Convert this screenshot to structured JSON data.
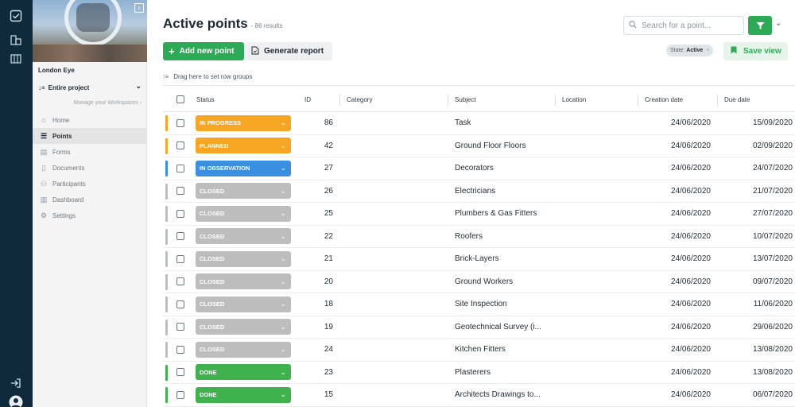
{
  "app": {
    "project_name": "London Eye",
    "scope": "Entire project",
    "manage_workspaces": "Manage your Workspaces"
  },
  "rail": {
    "icons": [
      "check-square-icon",
      "buildings-icon",
      "map-icon",
      "logout-icon",
      "user-avatar-icon"
    ]
  },
  "nav": [
    {
      "label": "Home",
      "icon": "home-icon"
    },
    {
      "label": "Points",
      "icon": "list-icon",
      "active": true
    },
    {
      "label": "Forms",
      "icon": "clipboard-icon"
    },
    {
      "label": "Documents",
      "icon": "document-icon"
    },
    {
      "label": "Participants",
      "icon": "people-icon"
    },
    {
      "label": "Dashboard",
      "icon": "chart-icon"
    },
    {
      "label": "Settings",
      "icon": "gear-icon"
    }
  ],
  "header": {
    "title": "Active points",
    "result_count": "- 86 results",
    "search_placeholder": "Search for a point...",
    "add_button": "Add new point",
    "report_button": "Generate report",
    "filter_chip_label": "State:",
    "filter_chip_value": "Active",
    "save_view_button": "Save view",
    "group_hint": "Drag here to set row groups"
  },
  "columns": {
    "status": "Status",
    "id": "ID",
    "category": "Category",
    "subject": "Subject",
    "location": "Location",
    "creation_date": "Creation date",
    "due_date": "Due date"
  },
  "status_colors": {
    "IN PROGRESS": "#f6a623",
    "PLANNED": "#f6a623",
    "IN OBSERVATION": "#3a8fe0",
    "CLOSED": "#bdbdbd",
    "DONE": "#3fb14d"
  },
  "rows": [
    {
      "status": "IN PROGRESS",
      "id": "86",
      "subject": "Task",
      "created": "24/06/2020",
      "due": "15/09/2020"
    },
    {
      "status": "PLANNED",
      "id": "42",
      "subject": "Ground Floor Floors",
      "created": "24/06/2020",
      "due": "02/09/2020"
    },
    {
      "status": "IN OBSERVATION",
      "id": "27",
      "subject": "Decorators",
      "created": "24/06/2020",
      "due": "24/07/2020"
    },
    {
      "status": "CLOSED",
      "id": "26",
      "subject": "Electricians",
      "created": "24/06/2020",
      "due": "21/07/2020"
    },
    {
      "status": "CLOSED",
      "id": "25",
      "subject": "Plumbers & Gas Fitters",
      "created": "24/06/2020",
      "due": "27/07/2020"
    },
    {
      "status": "CLOSED",
      "id": "22",
      "subject": "Roofers",
      "created": "24/06/2020",
      "due": "10/07/2020"
    },
    {
      "status": "CLOSED",
      "id": "21",
      "subject": "Brick-Layers",
      "created": "24/06/2020",
      "due": "13/07/2020"
    },
    {
      "status": "CLOSED",
      "id": "20",
      "subject": "Ground Workers",
      "created": "24/06/2020",
      "due": "09/07/2020"
    },
    {
      "status": "CLOSED",
      "id": "18",
      "subject": "Site Inspection",
      "created": "24/06/2020",
      "due": "11/06/2020"
    },
    {
      "status": "CLOSED",
      "id": "19",
      "subject": "Geotechnical Survey (i...",
      "created": "24/06/2020",
      "due": "29/06/2020"
    },
    {
      "status": "CLOSED",
      "id": "24",
      "subject": "Kitchen Fitters",
      "created": "24/06/2020",
      "due": "13/08/2020"
    },
    {
      "status": "DONE",
      "id": "23",
      "subject": "Plasterers",
      "created": "24/06/2020",
      "due": "13/08/2020"
    },
    {
      "status": "DONE",
      "id": "15",
      "subject": "Architects Drawings to...",
      "created": "24/06/2020",
      "due": "06/07/2020"
    }
  ]
}
